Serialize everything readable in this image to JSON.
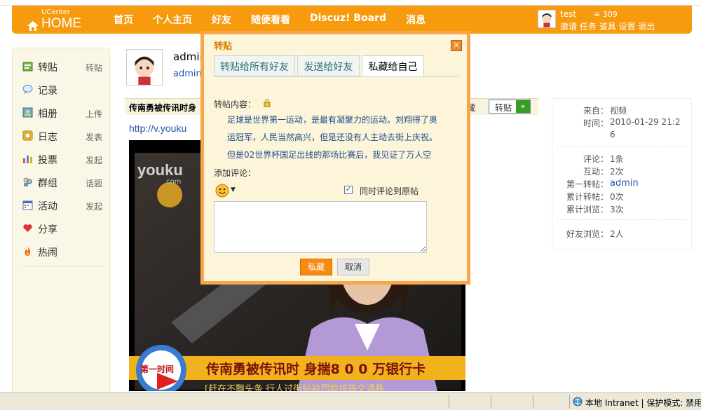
{
  "header": {
    "logo_small": "UCenter",
    "logo_main": "HOME",
    "nav": [
      "首页",
      "个人主页",
      "好友",
      "随便看看",
      "Discuz! Board",
      "消息"
    ],
    "user": {
      "name": "test",
      "credit": "309",
      "links": [
        "邀请",
        "任务",
        "道具",
        "设置",
        "退出"
      ]
    }
  },
  "sidebar": {
    "items": [
      {
        "label": "转贴",
        "action": "转贴",
        "icon": "share-post-icon"
      },
      {
        "label": "记录",
        "action": "",
        "icon": "speech-bubble-icon"
      },
      {
        "label": "相册",
        "action": "上传",
        "icon": "photo-album-icon"
      },
      {
        "label": "日志",
        "action": "发表",
        "icon": "blog-icon"
      },
      {
        "label": "投票",
        "action": "发起",
        "icon": "poll-chart-icon"
      },
      {
        "label": "群组",
        "action": "话题",
        "icon": "group-icon"
      },
      {
        "label": "活动",
        "action": "发起",
        "icon": "calendar-icon"
      },
      {
        "label": "分享",
        "action": "",
        "icon": "heart-share-icon"
      },
      {
        "label": "热闹",
        "action": "",
        "icon": "fire-icon"
      }
    ]
  },
  "profile": {
    "name": "admin",
    "link": "admin"
  },
  "post": {
    "title": "传南勇被传讯时身",
    "fav_label": "藏",
    "share_button": "转贴",
    "url": "http://v.youku"
  },
  "video": {
    "logo": "youku",
    "logo_sub": ".com",
    "caption": "传南勇被传讯时  身揣8 0 0 万银行卡",
    "badge": "第一时间",
    "subcaption": "[赶在不飘头条   行人过街贴被罚款排等交通秩"
  },
  "info": {
    "rows1": [
      {
        "key": "来自：",
        "value": "视频",
        "link": false
      },
      {
        "key": "时间：",
        "value": "2010-01-29 21:2",
        "value2": "6",
        "link": false
      }
    ],
    "rows2": [
      {
        "key": "评论：",
        "value": "1条",
        "link": false
      },
      {
        "key": "互动：",
        "value": "2次",
        "link": false
      },
      {
        "key": "第一转帖：",
        "value": "admin",
        "link": true
      },
      {
        "key": "累计转帖：",
        "value": "0次",
        "link": false
      },
      {
        "key": "累计浏览：",
        "value": "3次",
        "link": false
      }
    ],
    "rows3": [
      {
        "key": "好友浏览：",
        "value": "2人",
        "link": false
      }
    ]
  },
  "dialog": {
    "title": "转贴",
    "close": "×",
    "tabs": [
      "转贴给所有好友",
      "发送给好友",
      "私藏给自己"
    ],
    "content_label": "转帖内容：",
    "content_lines": [
      "足球是世界第一运动，是最有凝聚力的运动。刘翔得了奥",
      "运冠军，人民当然高兴，但是还没有人主动去街上庆祝。",
      "但是02世界杯国足出线的那场比赛后，我见证了万人空"
    ],
    "comment_label": "添加评论：",
    "sync_label": "同时评论到原帖",
    "sync_checked": true,
    "comment_value": "",
    "submit": "私藏",
    "cancel": "取消"
  },
  "statusbar": {
    "zone": "本地 Intranet | 保护模式: 禁用"
  },
  "colors": {
    "header": "#f79a0e",
    "dialog_border": "#f9a64a",
    "dialog_bg": "#fcf5da",
    "link": "#2255aa"
  }
}
